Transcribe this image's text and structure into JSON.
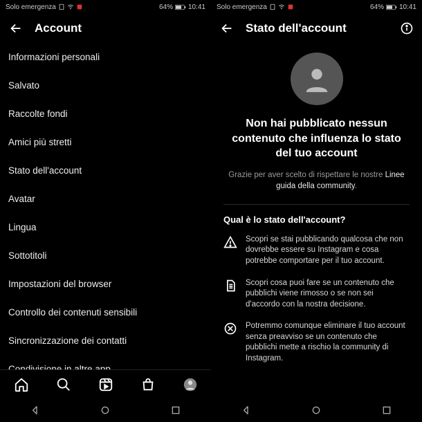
{
  "status": {
    "carrier": "Solo emergenza",
    "battery": "64%",
    "time": "10:41"
  },
  "left": {
    "title": "Account",
    "items": [
      "Informazioni personali",
      "Salvato",
      "Raccolte fondi",
      "Amici più stretti",
      "Stato dell'account",
      "Avatar",
      "Lingua",
      "Sottotitoli",
      "Impostazioni del browser",
      "Controllo dei contenuti sensibili",
      "Sincronizzazione dei contatti",
      "Condivisione in altre app"
    ]
  },
  "right": {
    "title": "Stato dell'account",
    "headline": "Non hai pubblicato nessun contenuto che influenza lo stato del tuo account",
    "subtext_prefix": "Grazie per aver scelto di rispettare le nostre ",
    "subtext_link": "Linee guida della community",
    "subtext_suffix": ".",
    "section_title": "Qual è lo stato dell'account?",
    "rows": [
      "Scopri se stai pubblicando qualcosa che non dovrebbe essere su Instagram e cosa potrebbe comportare per il tuo account.",
      "Scopri cosa puoi fare se un contenuto che pubblichi viene rimosso o se non sei d'accordo con la nostra decisione.",
      "Potremmo comunque eliminare il tuo account senza preavviso se un contenuto che pubblichi mette a rischio la community di Instagram."
    ]
  }
}
